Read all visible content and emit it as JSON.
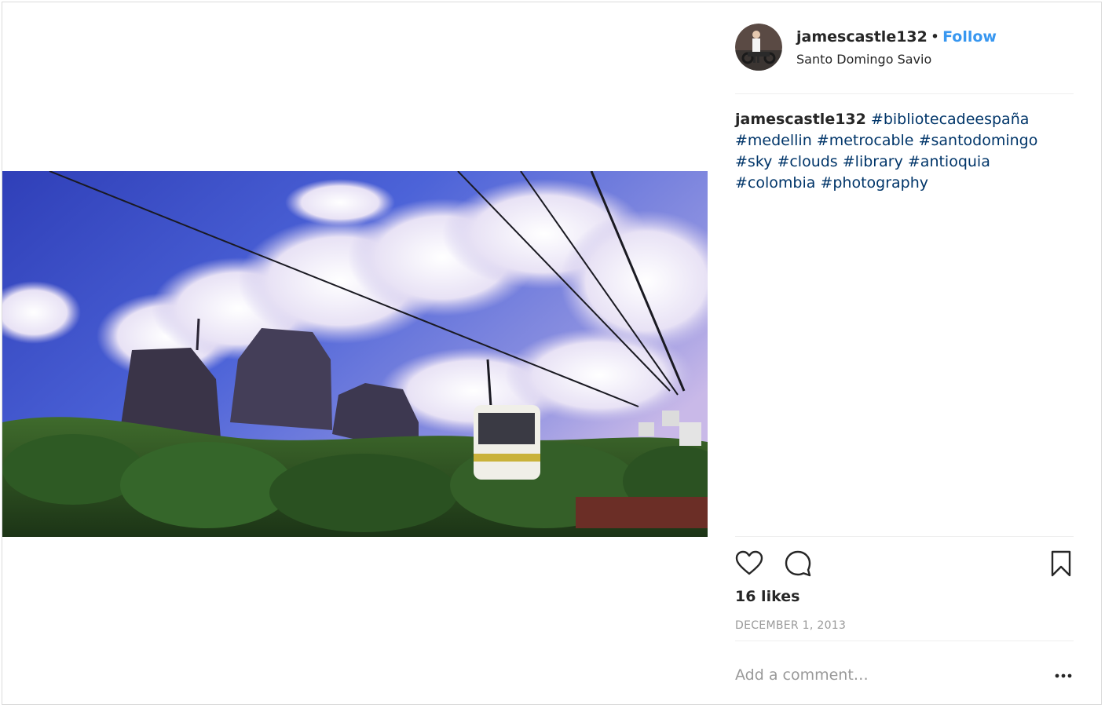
{
  "header": {
    "username": "jamescastle132",
    "bullet": "•",
    "follow_label": "Follow",
    "location": "Santo Domingo Savio"
  },
  "caption": {
    "username": "jamescastle132",
    "hashtags": [
      "#bibliotecadeespaña",
      "#medellin",
      "#metrocable",
      "#santodomingo",
      "#sky",
      "#clouds",
      "#library",
      "#antioquia",
      "#colombia",
      "#photography"
    ]
  },
  "actions": {
    "like_icon": "heart-icon",
    "comment_icon": "speech-bubble-icon",
    "save_icon": "bookmark-icon"
  },
  "likes": "16 likes",
  "date": "DECEMBER 1, 2013",
  "comment": {
    "placeholder": "Add a comment…",
    "more_icon": "ellipsis-icon"
  },
  "colors": {
    "follow": "#3897f0",
    "hashtag": "#003569",
    "text": "#262626",
    "muted": "#999999",
    "divider": "#efefef"
  }
}
